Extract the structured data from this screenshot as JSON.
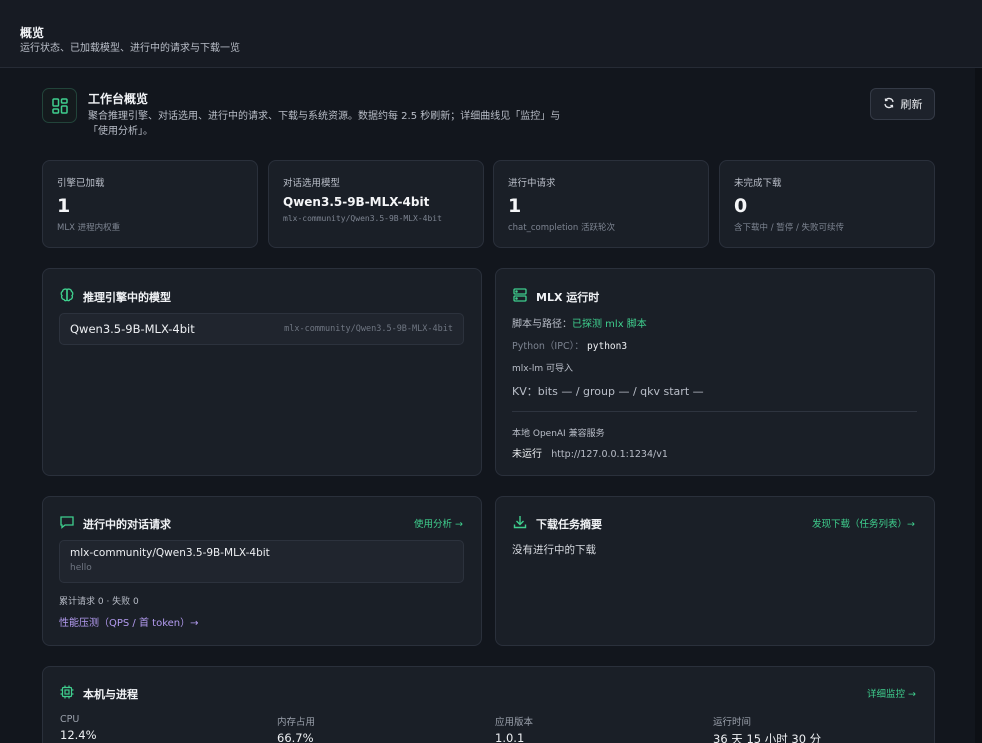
{
  "topbar": {
    "title": "概览",
    "subtitle": "运行状态、已加载模型、进行中的请求与下载一览"
  },
  "header": {
    "title": "工作台概览",
    "desc": "聚合推理引擎、对话选用、进行中的请求、下载与系统资源。数据约每 2.5 秒刷新；详细曲线见「监控」与「使用分析」。",
    "refresh_label": "刷新",
    "icon": "dashboard-icon"
  },
  "stats": [
    {
      "label": "引擎已加载",
      "value": "1",
      "note": "MLX 进程内权重"
    },
    {
      "label": "对话选用模型",
      "value": "Qwen3.5-9B-MLX-4bit",
      "note": "mlx-community/Qwen3.5-9B-MLX-4bit"
    },
    {
      "label": "进行中请求",
      "value": "1",
      "note": "chat_completion 活跃轮次"
    },
    {
      "label": "未完成下载",
      "value": "0",
      "note": "含下载中 / 暂停 / 失败可续传"
    }
  ],
  "engine": {
    "title": "推理引擎中的模型",
    "model_name": "Qwen3.5-9B-MLX-4bit",
    "model_repo": "mlx-community/Qwen3.5-9B-MLX-4bit"
  },
  "runtime": {
    "title": "MLX 运行时",
    "script_label": "脚本与路径：",
    "script_value": "已探测 mlx 脚本",
    "python_label": "Python（IPC）：",
    "python_value": "python3",
    "mlx_lm": "mlx-lm 可导入",
    "kv": "KV：bits — / group — / qkv start —",
    "openai_label": "本地 OpenAI 兼容服务",
    "openai_status": "未运行",
    "openai_url": "http://127.0.0.1:1234/v1"
  },
  "requests": {
    "title": "进行中的对话请求",
    "link": "使用分析 →",
    "item_model": "mlx-community/Qwen3.5-9B-MLX-4bit",
    "item_preview": "hello",
    "summary": "累计请求 0 · 失败 0",
    "bench_link": "性能压测（QPS / 首 token）→"
  },
  "downloads": {
    "title": "下载任务摘要",
    "link": "发现下载（任务列表）→",
    "empty": "没有进行中的下载"
  },
  "system": {
    "title": "本机与进程",
    "link": "详细监控 →",
    "cols": [
      {
        "label": "CPU",
        "value": "12.4%"
      },
      {
        "label": "内存占用",
        "value": "66.7%"
      },
      {
        "label": "应用版本",
        "value": "1.0.1"
      },
      {
        "label": "运行时间",
        "value": "36 天 15 小时 30 分"
      }
    ]
  },
  "colors": {
    "accent": "#3fcf8e",
    "purple": "#b39bf0",
    "background": "#12161d",
    "card": "#1a1f27"
  }
}
